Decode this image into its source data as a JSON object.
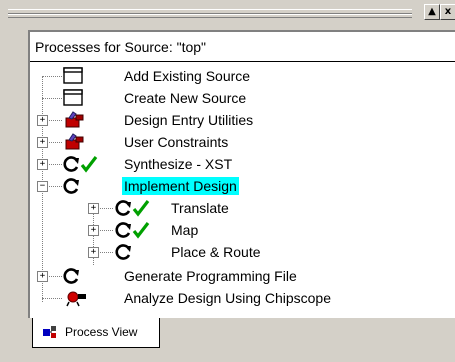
{
  "window": {
    "minimize_label": "▲",
    "close_label": "x"
  },
  "panel": {
    "header": "Processes for Source:  \"top\""
  },
  "tree": {
    "items": [
      {
        "label": "Add Existing Source",
        "icon": "window-icon",
        "status": ""
      },
      {
        "label": "Create New Source",
        "icon": "window-icon",
        "status": ""
      },
      {
        "label": "Design Entry Utilities",
        "icon": "toolbox-icon",
        "status": ""
      },
      {
        "label": "User Constraints",
        "icon": "toolbox-icon",
        "status": ""
      },
      {
        "label": "Synthesize - XST",
        "icon": "refresh-icon",
        "status": "checkmark"
      },
      {
        "label": "Implement Design",
        "icon": "refresh-icon",
        "status": ""
      },
      {
        "label": "Translate",
        "icon": "refresh-icon",
        "status": "checkmark"
      },
      {
        "label": "Map",
        "icon": "refresh-icon",
        "status": "checkmark"
      },
      {
        "label": "Place & Route",
        "icon": "refresh-icon",
        "status": ""
      },
      {
        "label": "Generate Programming File",
        "icon": "refresh-icon",
        "status": ""
      },
      {
        "label": "Analyze Design Using Chipscope",
        "icon": "chipscope-icon",
        "status": ""
      }
    ],
    "expander_plus": "+",
    "expander_minus": "−"
  },
  "tabs": {
    "process_view": "Process View"
  },
  "colors": {
    "selection": "#00ffff",
    "check": "#00a000"
  }
}
